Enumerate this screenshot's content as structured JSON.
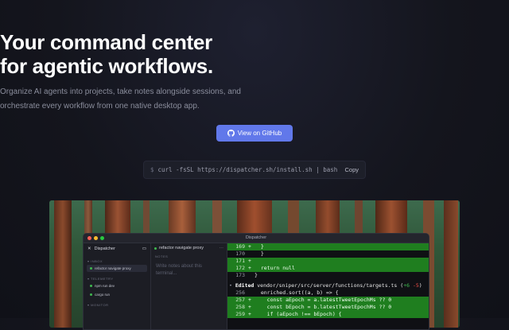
{
  "hero": {
    "title_line1": "Your command center",
    "title_line2": "for agentic workflows.",
    "subtitle_line1": "Organize AI agents into projects, take notes alongside sessions, and",
    "subtitle_line2": "orchestrate every workflow from one native desktop app.",
    "cta_label": "View on GitHub"
  },
  "install": {
    "prompt": "$",
    "command": "curl -fsSL https://dispatcher.sh/install.sh | bash",
    "copy_label": "Copy"
  },
  "app": {
    "window_title": "Dispatcher",
    "sidebar": {
      "app_name": "Dispatcher",
      "sections": [
        {
          "label": "INBOX",
          "items": [
            "refactor navigate proxy"
          ]
        },
        {
          "label": "TELEMETRY",
          "items": [
            "npm run dev",
            "cargo run"
          ]
        },
        {
          "label": "MONITOR",
          "items": []
        }
      ]
    },
    "notes": {
      "session_title": "refactor navigate proxy",
      "label": "NOTES",
      "placeholder_line1": "Write notes about this",
      "placeholder_line2": "terminal..."
    },
    "terminal": {
      "lines": [
        {
          "ln": "169",
          "mark": "+",
          "text": "  }",
          "kind": "add"
        },
        {
          "ln": "170",
          "mark": "",
          "text": "  }",
          "kind": "plain"
        },
        {
          "ln": "171",
          "mark": "+",
          "text": "",
          "kind": "add"
        },
        {
          "ln": "172",
          "mark": "+",
          "text": "  return null",
          "kind": "add"
        },
        {
          "ln": "173",
          "mark": "",
          "text": "}",
          "kind": "plain"
        }
      ],
      "edit": {
        "bullet": "•",
        "keyword": "Edited",
        "path": "vendor/sniper/src/server/functions/targets.ts",
        "added": "+6",
        "removed": "-5"
      },
      "lines2": [
        {
          "ln": "256",
          "mark": "",
          "text": "  enriched.sort((a, b) => {",
          "kind": "plain"
        },
        {
          "ln": "257",
          "mark": "+",
          "text": "    const aEpoch = a.latestTweetEpochMs ?? 0",
          "kind": "add"
        },
        {
          "ln": "258",
          "mark": "+",
          "text": "    const bEpoch = b.latestTweetEpochMs ?? 0",
          "kind": "add"
        },
        {
          "ln": "259",
          "mark": "+",
          "text": "    if (aEpoch !== bEpoch) {",
          "kind": "add"
        }
      ]
    }
  },
  "colors": {
    "accent": "#6178ea",
    "diff_add": "#1f7e1f",
    "background": "#14151d",
    "traffic_red": "#ff5f57",
    "traffic_yellow": "#febc2e",
    "traffic_green": "#28c840"
  }
}
